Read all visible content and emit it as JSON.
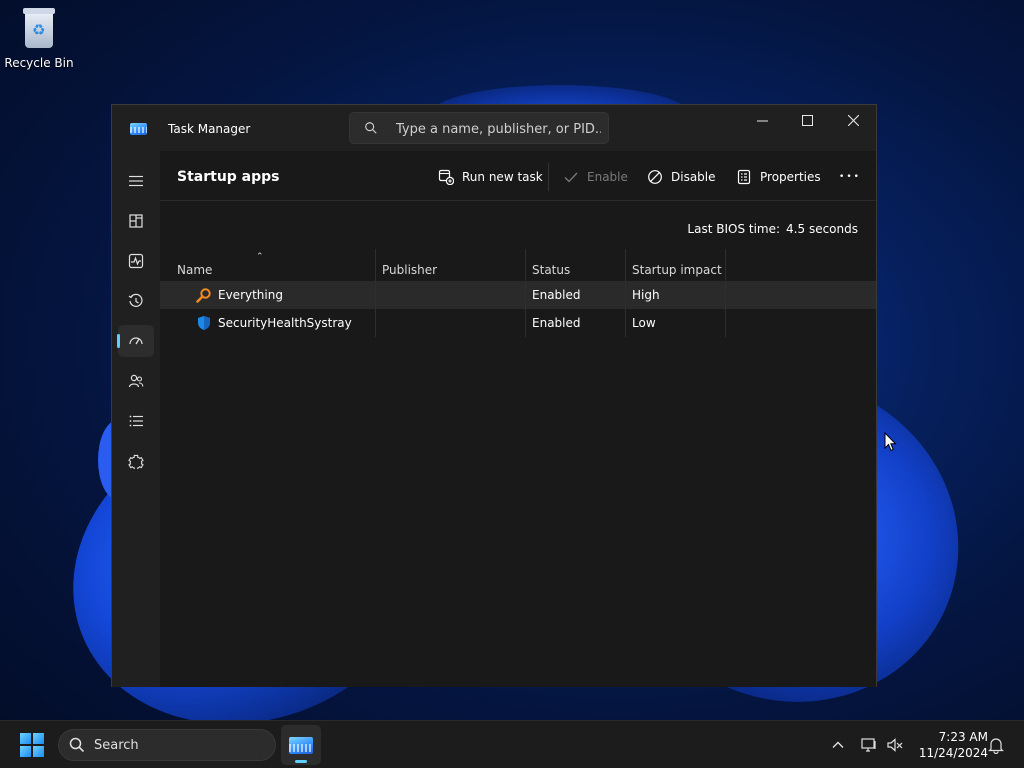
{
  "desktop": {
    "recycle_bin_label": "Recycle Bin"
  },
  "window": {
    "title": "Task Manager",
    "search_placeholder": "Type a name, publisher, or PID..."
  },
  "sidebar": {
    "items": [
      {
        "name": "menu",
        "icon": "hamburger-icon"
      },
      {
        "name": "processes",
        "icon": "processes-icon"
      },
      {
        "name": "performance",
        "icon": "performance-icon"
      },
      {
        "name": "app-history",
        "icon": "history-icon"
      },
      {
        "name": "startup-apps",
        "icon": "startup-icon",
        "active": true
      },
      {
        "name": "users",
        "icon": "users-icon"
      },
      {
        "name": "details",
        "icon": "details-icon"
      },
      {
        "name": "services",
        "icon": "services-icon"
      },
      {
        "name": "settings",
        "icon": "gear-icon"
      }
    ]
  },
  "page": {
    "title": "Startup apps",
    "run_new_task": "Run new task",
    "enable": "Enable",
    "disable": "Disable",
    "properties": "Properties",
    "more": "•••",
    "bios_label": "Last BIOS time:",
    "bios_value": "4.5 seconds"
  },
  "table": {
    "columns": {
      "name": "Name",
      "publisher": "Publisher",
      "status": "Status",
      "impact": "Startup impact"
    },
    "rows": [
      {
        "name": "Everything",
        "publisher": "",
        "status": "Enabled",
        "impact": "High",
        "icon": "search-magnifier-icon"
      },
      {
        "name": "SecurityHealthSystray",
        "publisher": "",
        "status": "Enabled",
        "impact": "Low",
        "icon": "shield-icon"
      }
    ]
  },
  "taskbar": {
    "search_label": "Search",
    "time": "7:23 AM",
    "date": "11/24/2024"
  },
  "colors": {
    "accent": "#60cdff",
    "window_bg": "#1c1c1c",
    "titlebar_bg": "#202020"
  }
}
